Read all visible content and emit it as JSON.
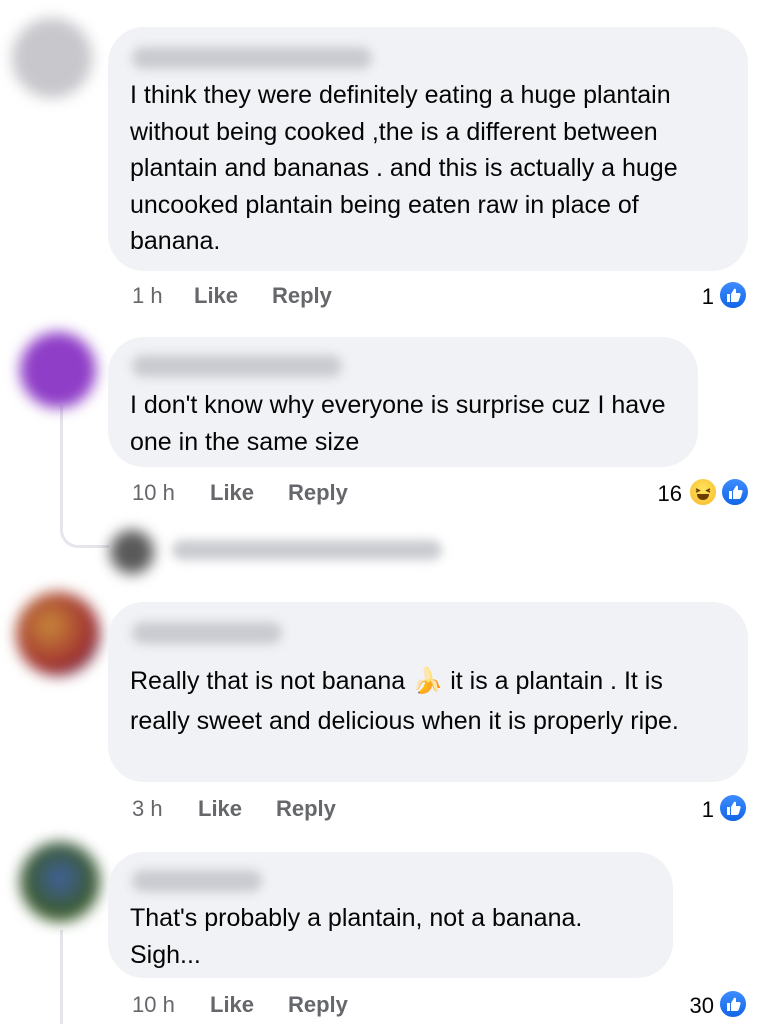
{
  "comments": [
    {
      "text": "I think they were definitely  eating a huge plantain without being cooked ,the is a different between plantain and bananas . and this is actually a huge uncooked plantain being eaten raw in place of banana.",
      "time": "1 h",
      "like_label": "Like",
      "reply_label": "Reply",
      "reaction_count": "1",
      "reactions": [
        "like-icon"
      ]
    },
    {
      "text": "I don't know why everyone is surprise cuz I have one in the same size",
      "time": "10 h",
      "like_label": "Like",
      "reply_label": "Reply",
      "reaction_count": "16",
      "reactions": [
        "haha-icon",
        "like-icon"
      ]
    },
    {
      "text_before": "Really that is not banana",
      "emoji": "🍌",
      "text_after": "it is a plantain . It is really sweet and delicious when it is properly ripe.",
      "time": "3 h",
      "like_label": "Like",
      "reply_label": "Reply",
      "reaction_count": "1",
      "reactions": [
        "like-icon"
      ]
    },
    {
      "text": "That's probably a plantain, not a banana. Sigh...",
      "time": "10 h",
      "like_label": "Like",
      "reply_label": "Reply",
      "reaction_count": "30",
      "reactions": [
        "like-icon"
      ]
    }
  ],
  "colors": {
    "bubble": "#f0f2f5",
    "meta_text": "#65676b",
    "like_blue": "#1877f2",
    "haha_yellow": "#f7b928"
  }
}
